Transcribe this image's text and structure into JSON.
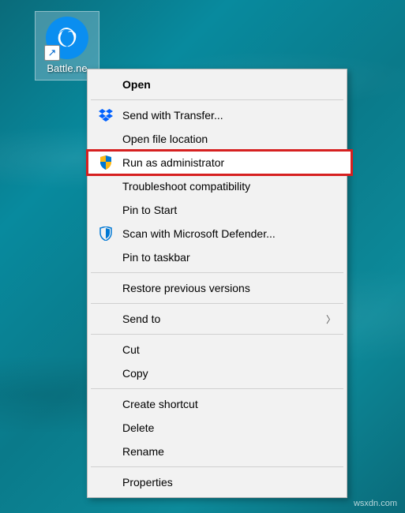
{
  "desktop": {
    "icon_label": "Battle.ne"
  },
  "menu": {
    "open": "Open",
    "send_with_transfer": "Send with Transfer...",
    "open_file_location": "Open file location",
    "run_as_admin": "Run as administrator",
    "troubleshoot": "Troubleshoot compatibility",
    "pin_to_start": "Pin to Start",
    "scan_defender": "Scan with Microsoft Defender...",
    "pin_to_taskbar": "Pin to taskbar",
    "restore_versions": "Restore previous versions",
    "send_to": "Send to",
    "cut": "Cut",
    "copy": "Copy",
    "create_shortcut": "Create shortcut",
    "delete": "Delete",
    "rename": "Rename",
    "properties": "Properties"
  },
  "watermark": "wsxdn.com"
}
